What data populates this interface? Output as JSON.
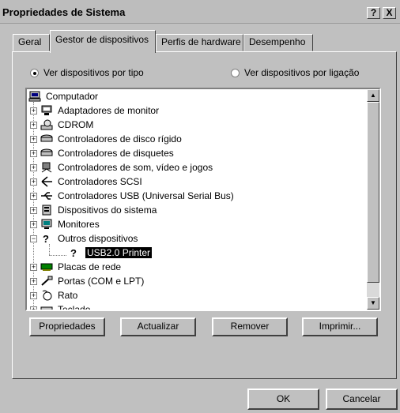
{
  "window": {
    "title": "Propriedades de Sistema",
    "help_label": "?",
    "close_label": "X"
  },
  "tabs": [
    {
      "label": "Geral"
    },
    {
      "label": "Gestor de dispositivos"
    },
    {
      "label": "Perfis de hardware"
    },
    {
      "label": "Desempenho"
    }
  ],
  "view_options": {
    "by_type": "Ver dispositivos por tipo",
    "by_connection": "Ver dispositivos por ligação",
    "selected": "by_type"
  },
  "device_tree": {
    "root": "Computador",
    "items": [
      {
        "label": "Adaptadores de monitor",
        "icon": "monitor-adapter-icon"
      },
      {
        "label": "CDROM",
        "icon": "cdrom-icon"
      },
      {
        "label": "Controladores de disco rígido",
        "icon": "hard-disk-controller-icon"
      },
      {
        "label": "Controladores de disquetes",
        "icon": "floppy-controller-icon"
      },
      {
        "label": "Controladores de som, vídeo e jogos",
        "icon": "sound-video-game-icon"
      },
      {
        "label": "Controladores SCSI",
        "icon": "scsi-icon"
      },
      {
        "label": "Controladores USB (Universal Serial Bus)",
        "icon": "usb-icon"
      },
      {
        "label": "Dispositivos do sistema",
        "icon": "system-device-icon"
      },
      {
        "label": "Monitores",
        "icon": "monitor-icon"
      },
      {
        "label": "Outros dispositivos",
        "icon": "unknown-device-icon"
      },
      {
        "label": "USB2.0 Printer",
        "icon": "unknown-device-icon"
      },
      {
        "label": "Placas de rede",
        "icon": "network-card-icon"
      },
      {
        "label": "Portas (COM e LPT)",
        "icon": "port-icon"
      },
      {
        "label": "Rato",
        "icon": "mouse-icon"
      },
      {
        "label": "Teclado",
        "icon": "keyboard-icon"
      }
    ],
    "selected": "USB2.0 Printer"
  },
  "buttons": {
    "properties": "Propriedades",
    "refresh": "Actualizar",
    "remove": "Remover",
    "print": "Imprimir...",
    "ok": "OK",
    "cancel": "Cancelar"
  },
  "colors": {
    "face": "#c0c0c0",
    "selection": "#000000",
    "tree_background": "#ffffff"
  }
}
